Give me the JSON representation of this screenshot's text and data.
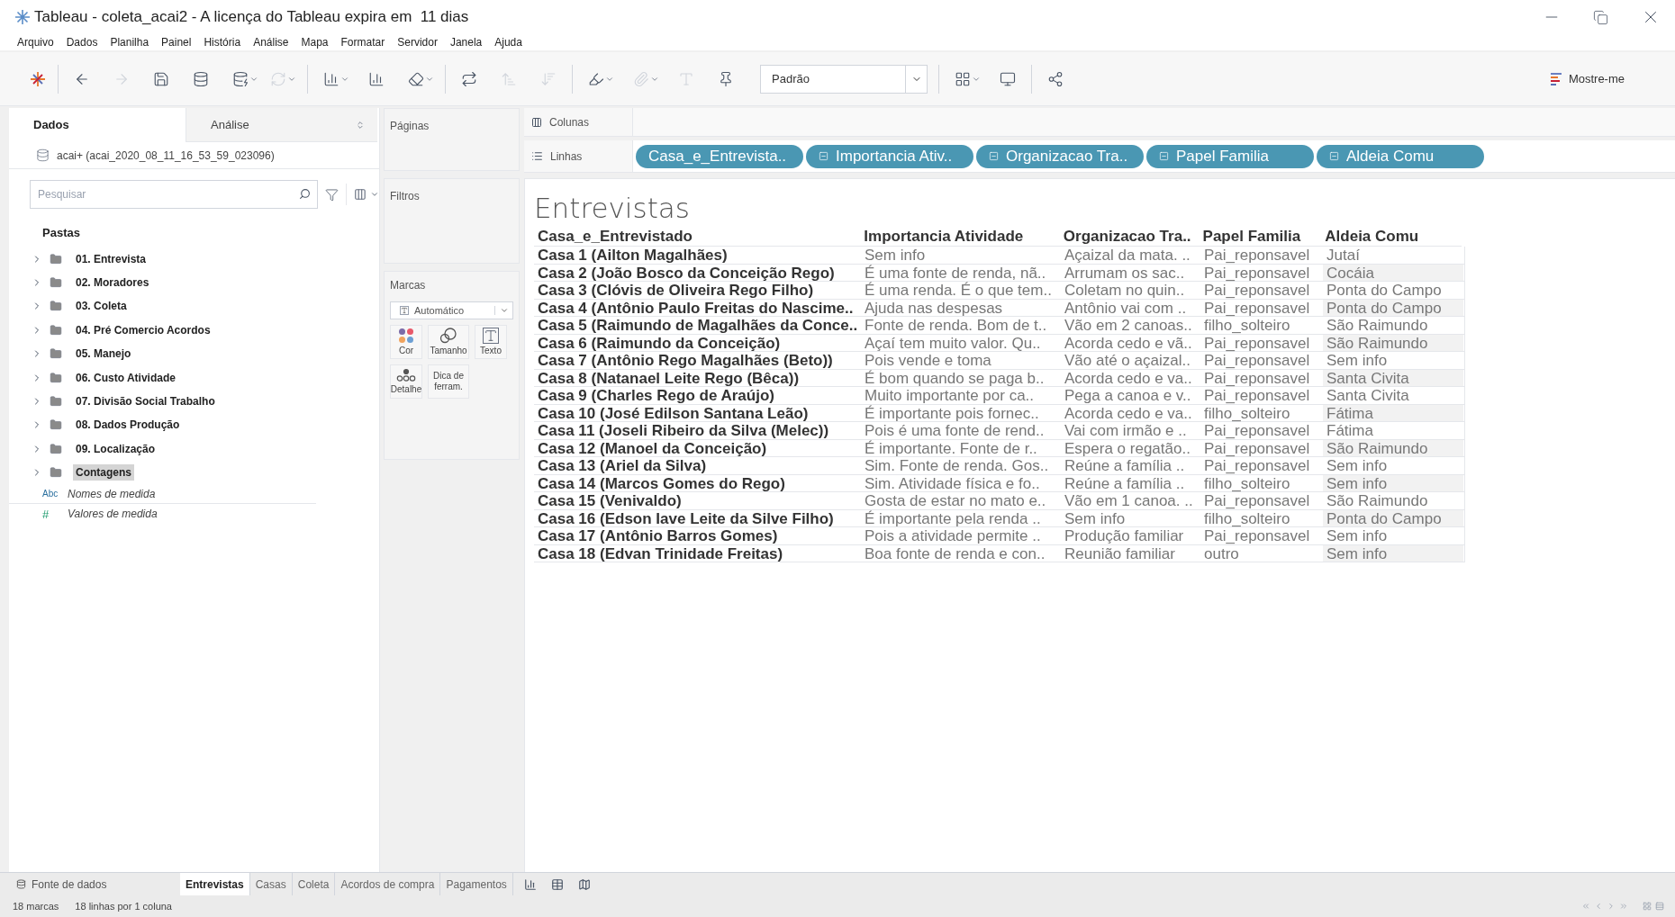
{
  "window": {
    "title": "Tableau - coleta_acai2 - A licença do Tableau expira em  11 dias"
  },
  "menu": [
    "Arquivo",
    "Dados",
    "Planilha",
    "Painel",
    "História",
    "Análise",
    "Mapa",
    "Formatar",
    "Servidor",
    "Janela",
    "Ajuda"
  ],
  "toolbar": {
    "fit": "Padrão",
    "show_me": "Mostre-me"
  },
  "data_pane": {
    "tabs": [
      {
        "label": "Dados",
        "selected": true
      },
      {
        "label": "Análise",
        "selected": false
      }
    ],
    "datasource": "acai+ (acai_2020_08_11_16_53_59_023096)",
    "search": {
      "placeholder": "Pesquisar"
    },
    "folders_title": "Pastas",
    "folders": [
      {
        "label": "01. Entrevista",
        "selected": false
      },
      {
        "label": "02. Moradores",
        "selected": false
      },
      {
        "label": "03. Coleta",
        "selected": false
      },
      {
        "label": "04. Pré Comercio Acordos",
        "selected": false
      },
      {
        "label": "05. Manejo",
        "selected": false
      },
      {
        "label": "06. Custo Atividade",
        "selected": false
      },
      {
        "label": "07. Divisão Social Trabalho",
        "selected": false
      },
      {
        "label": "08. Dados Produção",
        "selected": false
      },
      {
        "label": "09. Localização",
        "selected": false
      },
      {
        "label": "Contagens",
        "selected": true
      }
    ],
    "fields": [
      {
        "kind": "dimension",
        "badge": "Abc",
        "label": "Nomes de medida"
      },
      {
        "kind": "measure",
        "badge": "#",
        "label": "Valores de medida"
      }
    ]
  },
  "cards": {
    "pages": "Páginas",
    "filters": "Filtros",
    "marks": {
      "title": "Marcas",
      "type": "Automático",
      "buttons": [
        {
          "kind": "color",
          "label": "Cor"
        },
        {
          "kind": "size",
          "label": "Tamanho"
        },
        {
          "kind": "text",
          "label": "Texto"
        },
        {
          "kind": "detail",
          "label": "Detalhe"
        },
        {
          "kind": "tooltip",
          "label": "Dica de ferram."
        }
      ]
    }
  },
  "shelves": {
    "columns": {
      "label": "Colunas"
    },
    "rows": {
      "label": "Linhas",
      "pills": [
        {
          "label": "Casa_e_Entrevista..",
          "kind": "plain"
        },
        {
          "label": "Importancia Ativ..",
          "kind": "collapse"
        },
        {
          "label": "Organizacao Tra..",
          "kind": "collapse"
        },
        {
          "label": "Papel Familia",
          "kind": "collapse"
        },
        {
          "label": "Aldeia Comu",
          "kind": "collapse"
        }
      ]
    }
  },
  "table": {
    "title": "Entrevistas",
    "columns": [
      "Casa_e_Entrevistado",
      "Importancia Atividade",
      "Organizacao Tra..",
      "Papel Familia",
      "Aldeia Comu"
    ],
    "rows": [
      [
        "Casa 1 (Ailton Magalhães)",
        "Sem info",
        "Açaizal da mata. ..",
        "Pai_reponsavel",
        "Jutaí"
      ],
      [
        "Casa 2 (João Bosco da Conceição Rego)",
        "É uma fonte de renda, nã..",
        "Arrumam os sac..",
        "Pai_reponsavel",
        "Cocáia"
      ],
      [
        "Casa 3 (Clóvis de Oliveira Rego Filho)",
        "É uma renda. É o que tem..",
        "Coletam no quin..",
        "Pai_reponsavel",
        "Ponta do Campo"
      ],
      [
        "Casa 4 (Antônio Paulo Freitas do Nascime..",
        "Ajuda nas despesas",
        "Antônio vai com ..",
        "Pai_reponsavel",
        "Ponta do Campo"
      ],
      [
        "Casa 5 (Raimundo de Magalhães da Conce..",
        "Fonte de renda. Bom de t..",
        "Vão em 2 canoas..",
        "filho_solteiro",
        "São Raimundo"
      ],
      [
        "Casa 6 (Raimundo da Conceição)",
        "Açaí tem muito valor. Qu..",
        "Acorda cedo e vã..",
        "Pai_reponsavel",
        "São Raimundo"
      ],
      [
        "Casa 7 (Antônio Rego Magalhães (Beto))",
        "Pois vende e toma",
        "Vão até o açaizal..",
        "Pai_reponsavel",
        "Sem info"
      ],
      [
        "Casa 8 (Natanael Leite Rego (Bêca))",
        "É bom quando se paga b..",
        "Acorda cedo e va..",
        "Pai_reponsavel",
        "Santa Civita"
      ],
      [
        "Casa 9 (Charles Rego de Araújo)",
        "Muito importante por ca..",
        "Pega a canoa e v..",
        "Pai_reponsavel",
        "Santa Civita"
      ],
      [
        "Casa 10 (José Edilson Santana Leão)",
        "É importante pois fornec..",
        "Acorda cedo e va..",
        "filho_solteiro",
        "Fátima"
      ],
      [
        "Casa 11 (Joseli Ribeiro da Silva (Melec))",
        "Pois é uma fonte de rend..",
        "Vai com irmão e ..",
        "Pai_reponsavel",
        "Fátima"
      ],
      [
        "Casa 12 (Manoel da Conceição)",
        "É importante. Fonte de r..",
        "Espera o regatão..",
        "Pai_reponsavel",
        "São Raimundo"
      ],
      [
        "Casa 13 (Ariel da Silva)",
        "Sim. Fonte de renda. Gos..",
        "Reúne a família ..",
        "Pai_reponsavel",
        "Sem info"
      ],
      [
        "Casa 14 (Marcos Gomes do Rego)",
        "Sim. Atividade física e fo..",
        "Reúne a família ..",
        "filho_solteiro",
        "Sem info"
      ],
      [
        "Casa 15 (Venivaldo)",
        "Gosta de estar no mato e..",
        "Vão em 1 canoa. ..",
        "Pai_reponsavel",
        "São Raimundo"
      ],
      [
        "Casa 16 (Edson Iave Leite da Silve Filho)",
        "É importante pela renda ..",
        "Sem info",
        "filho_solteiro",
        "Ponta do Campo"
      ],
      [
        "Casa 17 (Antônio Barros Gomes)",
        "Pois a atividade permite ..",
        "Produção familiar",
        "Pai_reponsavel",
        "Sem info"
      ],
      [
        "Casa 18 (Edvan Trinidade Freitas)",
        "Boa fonte de renda e con..",
        "Reunião familiar",
        "outro",
        "Sem info"
      ]
    ]
  },
  "sheet_tabs": {
    "datasource": "Fonte de dados",
    "sheets": [
      {
        "label": "Entrevistas",
        "selected": true
      },
      {
        "label": "Casas",
        "selected": false
      },
      {
        "label": "Coleta",
        "selected": false
      },
      {
        "label": "Acordos de compra",
        "selected": false
      },
      {
        "label": "Pagamentos",
        "selected": false
      }
    ]
  },
  "status_bar": [
    "18 marcas",
    "18 linhas por 1 coluna"
  ]
}
